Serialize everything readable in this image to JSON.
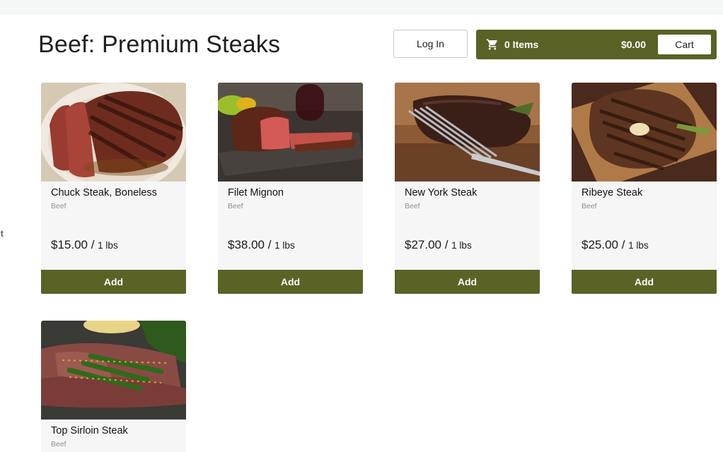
{
  "side_nav": {
    "clipped_text": "it"
  },
  "page": {
    "title": "Beef: Premium Steaks"
  },
  "header": {
    "login_label": "Log In",
    "cart": {
      "items_label": "0 Items",
      "total": "$0.00",
      "button_label": "Cart"
    }
  },
  "colors": {
    "accent": "#5a6225",
    "card_bg": "#f7f6f6",
    "topbar": "#f5f6f6"
  },
  "products": [
    {
      "name": "Chuck Steak, Boneless",
      "category": "Beef",
      "price": "$15.00 / ",
      "unit": "1 lbs",
      "add_label": "Add"
    },
    {
      "name": "Filet Mignon",
      "category": "Beef",
      "price": "$38.00 / ",
      "unit": "1 lbs",
      "add_label": "Add"
    },
    {
      "name": "New York Steak",
      "category": "Beef",
      "price": "$27.00 / ",
      "unit": "1 lbs",
      "add_label": "Add"
    },
    {
      "name": "Ribeye Steak",
      "category": "Beef",
      "price": "$25.00 / ",
      "unit": "1 lbs",
      "add_label": "Add"
    },
    {
      "name": "Top Sirloin Steak",
      "category": "Beef"
    }
  ]
}
